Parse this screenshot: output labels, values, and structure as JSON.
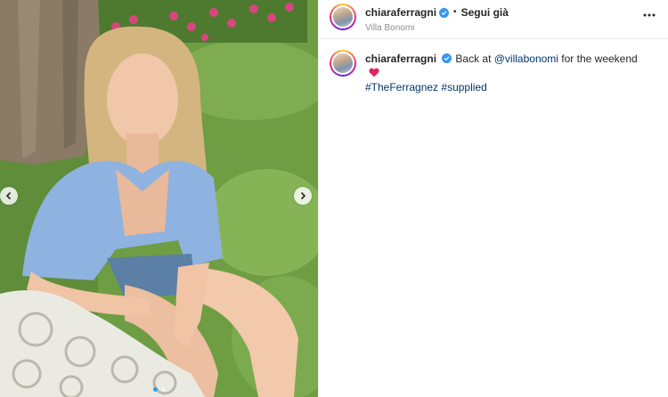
{
  "post": {
    "username": "chiaraferragni",
    "follow_status": "Segui già",
    "separator": "•",
    "location": "Villa Bonomi",
    "caption": {
      "username": "chiaraferragni",
      "text_before": "Back at ",
      "mention": "@villabonomi",
      "text_after": " for the weekend",
      "hashtags": [
        "#TheFerragnez",
        "#supplied"
      ],
      "emoji": "heart-emoji"
    }
  },
  "carousel": {
    "slide_count": 2,
    "active_slide": 1
  },
  "icons": {
    "verified": "verified-badge-icon",
    "more": "more-options-icon",
    "prev": "chevron-left-icon",
    "next": "chevron-right-icon"
  },
  "colors": {
    "verified_blue": "#3897f0",
    "link_blue": "#00376b",
    "muted_text": "#8e8e8e",
    "heart_red": "#e0245e"
  }
}
